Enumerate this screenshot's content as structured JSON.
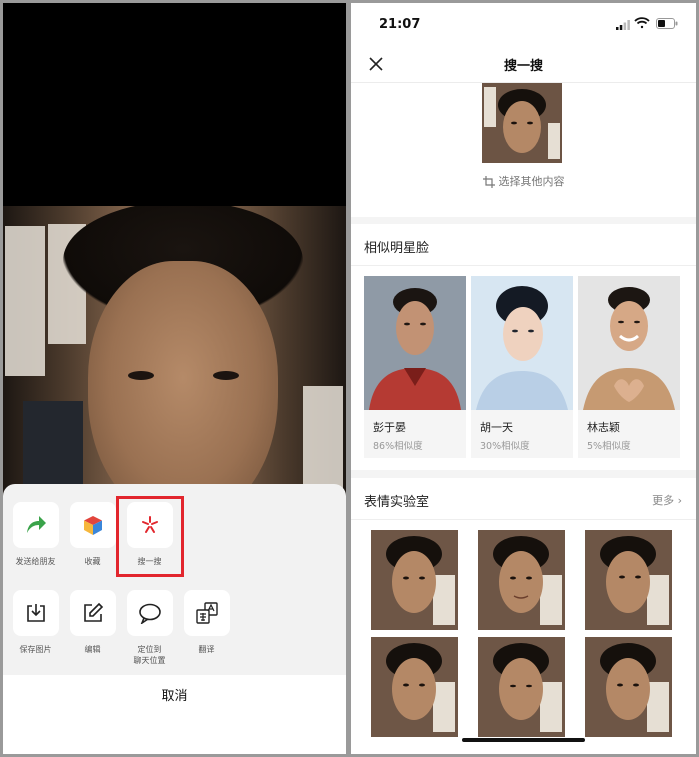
{
  "left": {
    "actions_row1": [
      {
        "label": "发送给朋友",
        "icon": "share-arrow-icon"
      },
      {
        "label": "收藏",
        "icon": "cube-icon"
      },
      {
        "label": "搜一搜",
        "icon": "search-spark-icon"
      }
    ],
    "actions_row2": [
      {
        "label": "保存图片",
        "icon": "download-icon"
      },
      {
        "label": "编辑",
        "icon": "edit-icon"
      },
      {
        "label": "定位到\n聊天位置",
        "icon": "chat-bubble-icon"
      },
      {
        "label": "翻译",
        "icon": "translate-icon"
      }
    ],
    "cancel_label": "取消",
    "highlight_color": "#e2262d"
  },
  "right": {
    "status": {
      "time": "21:07"
    },
    "nav": {
      "title": "搜一搜"
    },
    "choose_label": "选择其他内容",
    "celeb_section": {
      "title": "相似明星脸",
      "cards": [
        {
          "name": "彭于晏",
          "similarity": "86%相似度"
        },
        {
          "name": "胡一天",
          "similarity": "30%相似度"
        },
        {
          "name": "林志颖",
          "similarity": "5%相似度"
        }
      ]
    },
    "emoji_section": {
      "title": "表情实验室",
      "more_label": "更多"
    }
  }
}
